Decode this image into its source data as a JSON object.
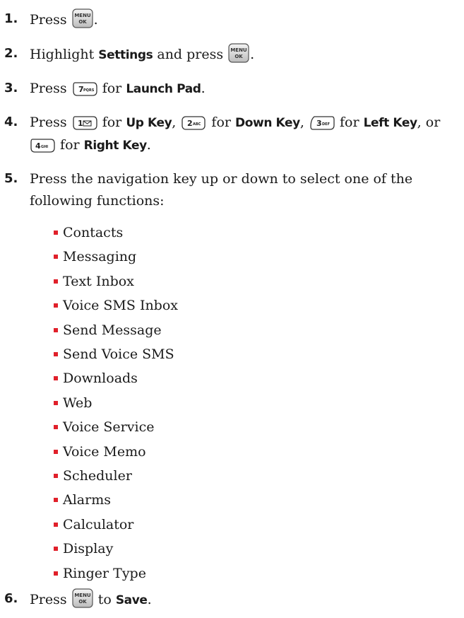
{
  "colors": {
    "bullet": "#e0202a",
    "text": "#1a1a1a"
  },
  "icons": {
    "menu_ok": {
      "line1": "MENU",
      "line2": "OK"
    },
    "key7": {
      "digit": "7",
      "letters": "PQRS"
    },
    "key1": {
      "digit": "1",
      "glyph": "envelope"
    },
    "key2": {
      "digit": "2",
      "letters": "ABC"
    },
    "key3": {
      "digit": "3",
      "letters": "DEF"
    },
    "key4": {
      "digit": "4",
      "letters": "GHI"
    }
  },
  "steps": [
    {
      "num": "1.",
      "before": "Press",
      "after": "."
    },
    {
      "num": "2.",
      "t1": "Highlight ",
      "b1": "Settings",
      "t2": " and press",
      "after": "."
    },
    {
      "num": "3.",
      "t1": "Press",
      "t2": " for ",
      "b1": "Launch Pad",
      "after": "."
    },
    {
      "num": "4.",
      "t1": "Press",
      "t2": " for ",
      "b1": "Up Key",
      "t3": ",",
      "t4": " for ",
      "b2": "Down Key",
      "t5": ",",
      "t6": " for ",
      "b3": "Left Key",
      "t7": ", or",
      "t8": " for ",
      "b4": "Right Key",
      "t9": "."
    },
    {
      "num": "5.",
      "line1": "Press the navigation key up or down to select one of the",
      "line2": "following functions:"
    },
    {
      "num": "6.",
      "t1": "Press",
      "t2": " to ",
      "b1": "Save",
      "after": "."
    }
  ],
  "functions": [
    "Contacts",
    "Messaging",
    "Text Inbox",
    "Voice SMS Inbox",
    "Send Message",
    "Send Voice SMS",
    "Downloads",
    "Web",
    "Voice Service",
    "Voice Memo",
    "Scheduler",
    "Alarms",
    "Calculator",
    "Display",
    "Ringer Type"
  ]
}
